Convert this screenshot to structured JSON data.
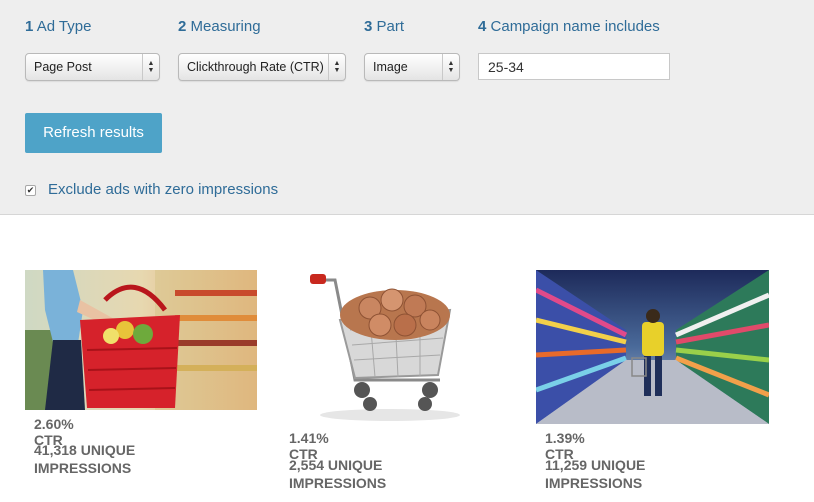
{
  "filters": {
    "steps": [
      {
        "num": "1",
        "label": "Ad Type",
        "value": "Page Post"
      },
      {
        "num": "2",
        "label": "Measuring",
        "value": "Clickthrough Rate (CTR)"
      },
      {
        "num": "3",
        "label": "Part",
        "value": "Image"
      },
      {
        "num": "4",
        "label": "Campaign name includes",
        "value": "25-34"
      }
    ],
    "refresh_label": "Refresh results",
    "exclude_label": "Exclude ads with zero impressions",
    "exclude_checked": true
  },
  "results": [
    {
      "ctr": "2.60% CTR",
      "impressions_line1": "41,318 UNIQUE",
      "impressions_line2": "IMPRESSIONS",
      "image": "woman-shopping-basket-photo"
    },
    {
      "ctr": "1.41% CTR",
      "impressions_line1": "2,554 UNIQUE",
      "impressions_line2": "IMPRESSIONS",
      "image": "cart-with-coins-photo"
    },
    {
      "ctr": "1.39% CTR",
      "impressions_line1": "11,259 UNIQUE",
      "impressions_line2": "IMPRESSIONS",
      "image": "supermarket-aisle-photo"
    }
  ]
}
